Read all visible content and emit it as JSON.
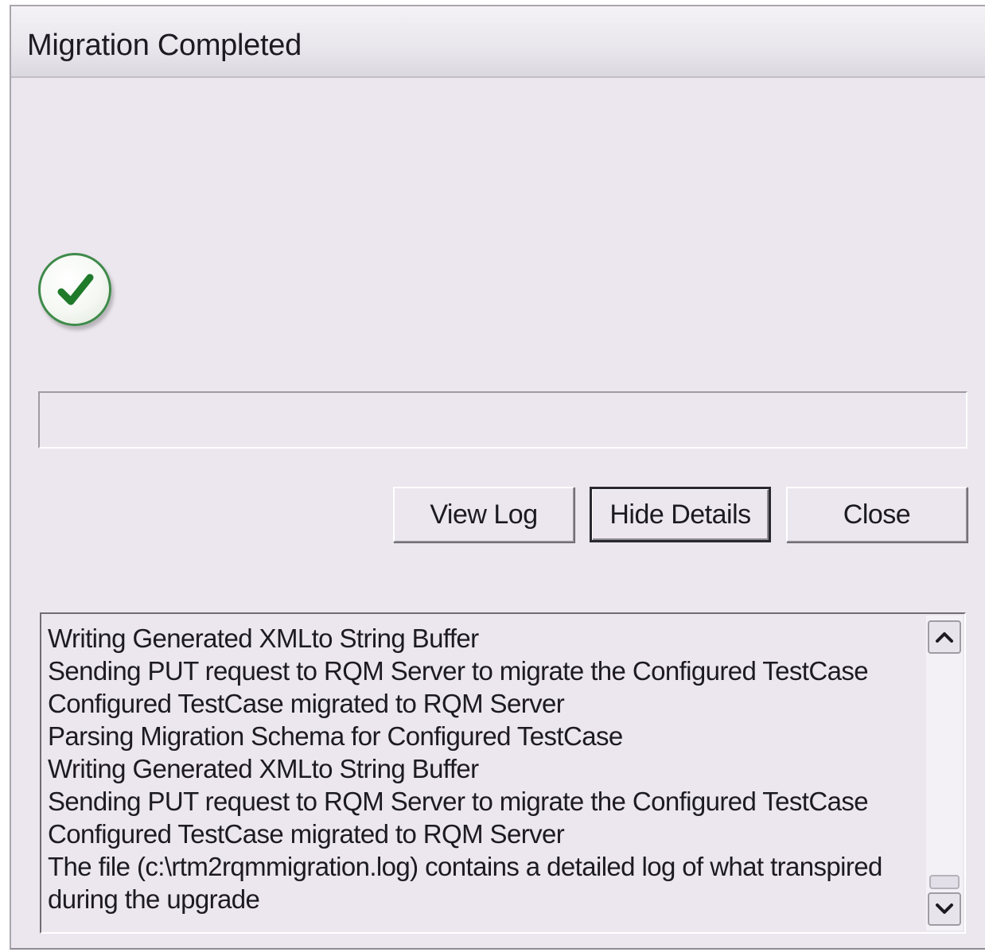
{
  "window": {
    "title": "Migration Completed"
  },
  "status": {
    "icon": "checkmark-success-icon",
    "icon_color": "#1f7a2a"
  },
  "progress": {
    "value": 0
  },
  "buttons": {
    "view_log": "View Log",
    "hide_details": "Hide Details",
    "close": "Close"
  },
  "details": {
    "lines": [
      "Writing Generated XMLto String Buffer",
      "Sending PUT request to RQM Server to migrate the Configured TestCase",
      "Configured TestCase migrated to RQM Server",
      "Parsing Migration Schema for Configured TestCase",
      "Writing Generated XMLto String Buffer",
      "Sending PUT request to RQM Server to migrate the Configured TestCase",
      "Configured TestCase migrated to RQM Server",
      "The file (c:\\rtm2rqmmigration.log) contains a detailed log of what transpired",
      "during the upgrade"
    ]
  },
  "scrollbar": {
    "up_icon": "chevron-up-icon",
    "down_icon": "chevron-down-icon"
  }
}
